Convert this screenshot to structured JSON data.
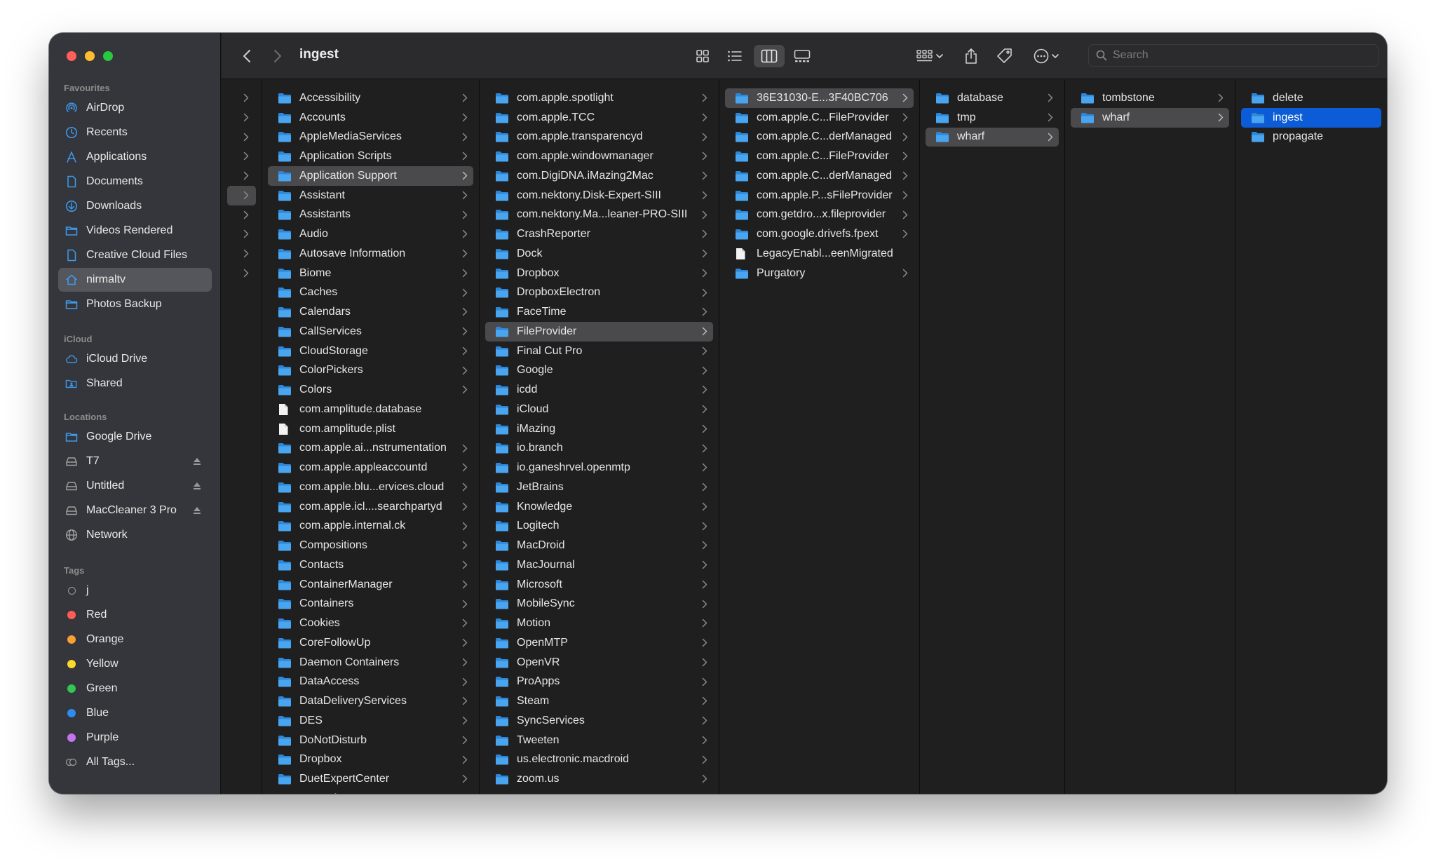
{
  "window": {
    "title": "ingest",
    "search_placeholder": "Search"
  },
  "sidebar": {
    "favourites_header": "Favourites",
    "favourites": [
      {
        "label": "AirDrop",
        "icon": "airdrop-icon"
      },
      {
        "label": "Recents",
        "icon": "clock-icon"
      },
      {
        "label": "Applications",
        "icon": "applications-icon"
      },
      {
        "label": "Documents",
        "icon": "document-icon"
      },
      {
        "label": "Downloads",
        "icon": "download-icon"
      },
      {
        "label": "Videos Rendered",
        "icon": "folder-icon"
      },
      {
        "label": "Creative Cloud Files",
        "icon": "document-icon"
      },
      {
        "label": "nirmaltv",
        "icon": "home-icon"
      },
      {
        "label": "Photos Backup",
        "icon": "folder-icon"
      }
    ],
    "icloud_header": "iCloud",
    "icloud": [
      {
        "label": "iCloud Drive",
        "icon": "cloud-icon"
      },
      {
        "label": "Shared",
        "icon": "shared-folder-icon"
      }
    ],
    "locations_header": "Locations",
    "locations": [
      {
        "label": "Google Drive",
        "icon": "folder-icon"
      },
      {
        "label": "T7",
        "icon": "drive-icon"
      },
      {
        "label": "Untitled",
        "icon": "drive-icon"
      },
      {
        "label": "MacCleaner 3 Pro",
        "icon": "drive-icon"
      },
      {
        "label": "Network",
        "icon": "globe-icon"
      }
    ],
    "tags_header": "Tags",
    "tags": [
      {
        "label": "j",
        "color": ""
      },
      {
        "label": "Red",
        "color": "#ff5b57"
      },
      {
        "label": "Orange",
        "color": "#f7a130"
      },
      {
        "label": "Yellow",
        "color": "#fadb2b"
      },
      {
        "label": "Green",
        "color": "#31c750"
      },
      {
        "label": "Blue",
        "color": "#2d8cf0"
      },
      {
        "label": "Purple",
        "color": "#c474f0"
      },
      {
        "label": "All Tags...",
        "color": "all"
      }
    ]
  },
  "columns": {
    "col2": [
      "Accessibility",
      "Accounts",
      "AppleMediaServices",
      "Application Scripts",
      "Application Support",
      "Assistant",
      "Assistants",
      "Audio",
      "Autosave Information",
      "Biome",
      "Caches",
      "Calendars",
      "CallServices",
      "CloudStorage",
      "ColorPickers",
      "Colors",
      "com.amplitude.database",
      "com.amplitude.plist",
      "com.apple.ai...nstrumentation",
      "com.apple.appleaccountd",
      "com.apple.blu...ervices.cloud",
      "com.apple.icl....searchpartyd",
      "com.apple.internal.ck",
      "Compositions",
      "Contacts",
      "ContainerManager",
      "Containers",
      "Cookies",
      "CoreFollowUp",
      "Daemon Containers",
      "DataAccess",
      "DataDeliveryServices",
      "DES",
      "DoNotDisturb",
      "Dropbox",
      "DuetExpertCenter",
      "Favourites"
    ],
    "col3": [
      "com.apple.spotlight",
      "com.apple.TCC",
      "com.apple.transparencyd",
      "com.apple.windowmanager",
      "com.DigiDNA.iMazing2Mac",
      "com.nektony.Disk-Expert-SIII",
      "com.nektony.Ma...leaner-PRO-SIII",
      "CrashReporter",
      "Dock",
      "Dropbox",
      "DropboxElectron",
      "FaceTime",
      "FileProvider",
      "Final Cut Pro",
      "Google",
      "icdd",
      "iCloud",
      "iMazing",
      "io.branch",
      "io.ganeshrvel.openmtp",
      "JetBrains",
      "Knowledge",
      "Logitech",
      "MacDroid",
      "MacJournal",
      "Microsoft",
      "MobileSync",
      "Motion",
      "OpenMTP",
      "OpenVR",
      "ProApps",
      "Steam",
      "SyncServices",
      "Tweeten",
      "us.electronic.macdroid",
      "zoom.us"
    ],
    "col4": [
      "36E31030-E...3F40BC706",
      "com.apple.C...FileProvider",
      "com.apple.C...derManaged",
      "com.apple.C...FileProvider",
      "com.apple.C...derManaged",
      "com.apple.P...sFileProvider",
      "com.getdro...x.fileprovider",
      "com.google.drivefs.fpext",
      "LegacyEnabl...eenMigrated",
      "Purgatory"
    ],
    "col5": [
      "database",
      "tmp",
      "wharf"
    ],
    "col6": [
      "tombstone",
      "wharf"
    ],
    "col7": [
      "delete",
      "ingest",
      "propagate"
    ]
  },
  "colors": {
    "selection_accent": "#0b5cd6",
    "folder_blue": "#4aa5f0"
  }
}
